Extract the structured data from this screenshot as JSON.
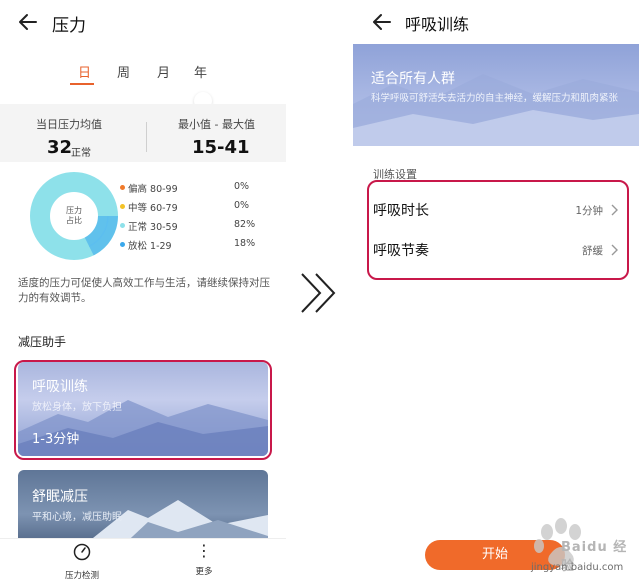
{
  "left": {
    "title": "压力",
    "tabs": [
      "日",
      "周",
      "月",
      "年"
    ],
    "active_tab": 0,
    "stats": {
      "avg_label": "当日压力均值",
      "avg_value": "32",
      "avg_unit": "正常",
      "range_label": "最小值 - 最大值",
      "range_value": "15-41"
    },
    "donut": {
      "center_label": "压力\n占比"
    },
    "legend": [
      {
        "name": "偏高 80-99",
        "pct": "0%",
        "color": "#f07a2a"
      },
      {
        "name": "中等 60-79",
        "pct": "0%",
        "color": "#f3c327"
      },
      {
        "name": "正常 30-59",
        "pct": "82%",
        "color": "#8ee1ea"
      },
      {
        "name": "放松 1-29",
        "pct": "18%",
        "color": "#3aa8ec"
      }
    ],
    "description": "适度的压力可促使人高效工作与生活，请继续保持对压力的有效调节。",
    "section_title": "减压助手",
    "card1": {
      "title": "呼吸训练",
      "subtitle": "放松身体，放下负担",
      "time": "1-3分钟"
    },
    "card2": {
      "title": "舒眠减压",
      "subtitle": "平和心境，减压助眠"
    },
    "nav": [
      {
        "label": "压力检测",
        "icon": "gauge-icon"
      },
      {
        "label": "更多",
        "icon": "more-icon"
      }
    ]
  },
  "right": {
    "title": "呼吸训练",
    "banner_title": "适合所有人群",
    "banner_sub": "科学呼吸可舒活失去活力的自主神经，缓解压力和肌肉紧张",
    "settings_title": "训练设置",
    "rows": [
      {
        "label": "呼吸时长",
        "value": "1分钟"
      },
      {
        "label": "呼吸节奏",
        "value": "舒缓"
      }
    ],
    "start_label": "开始"
  },
  "watermark": {
    "brand": "Baidu 经验",
    "url": "jingyan.baidu.com"
  },
  "colors": {
    "accent": "#e8622c",
    "highlight": "#c8184a",
    "start_button": "#f06a2a"
  }
}
